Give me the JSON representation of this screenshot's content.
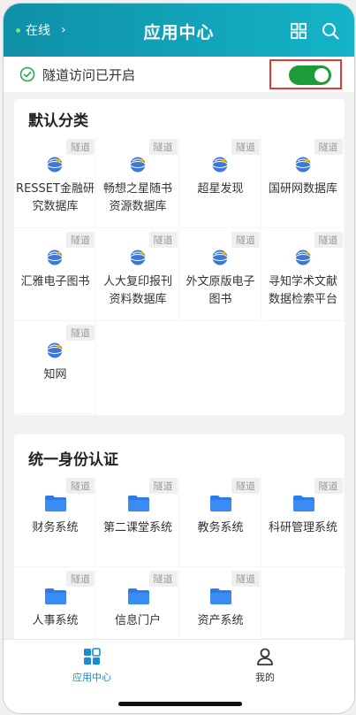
{
  "header": {
    "status_label": "在线",
    "title": "应用中心",
    "icons": [
      "chevron-right-icon",
      "grid-icon",
      "search-icon"
    ]
  },
  "tunnel": {
    "text": "隧道访问已开启",
    "enabled": true,
    "colors": {
      "toggle_on": "#1f9c3a",
      "highlight_border": "#e53935"
    }
  },
  "sections": [
    {
      "title": "默认分类",
      "icon": "globe-icon",
      "apps": [
        {
          "label": "RESSET金融研究数据库",
          "badge": "隧道"
        },
        {
          "label": "畅想之星随书资源数据库",
          "badge": "隧道"
        },
        {
          "label": "超星发现",
          "badge": "隧道"
        },
        {
          "label": "国研网数据库",
          "badge": "隧道"
        },
        {
          "label": "汇雅电子图书",
          "badge": "隧道"
        },
        {
          "label": "人大复印报刊资料数据库",
          "badge": "隧道"
        },
        {
          "label": "外文原版电子图书",
          "badge": "隧道"
        },
        {
          "label": "寻知学术文献数据检索平台",
          "badge": "隧道"
        },
        {
          "label": "知网",
          "badge": "隧道"
        }
      ]
    },
    {
      "title": "统一身份认证",
      "icon": "folder-icon",
      "apps": [
        {
          "label": "财务系统",
          "badge": "隧道"
        },
        {
          "label": "第二课堂系统",
          "badge": "隧道"
        },
        {
          "label": "教务系统",
          "badge": "隧道"
        },
        {
          "label": "科研管理系统",
          "badge": "隧道"
        },
        {
          "label": "人事系统",
          "badge": "隧道"
        },
        {
          "label": "信息门户",
          "badge": "隧道"
        },
        {
          "label": "资产系统",
          "badge": "隧道"
        }
      ]
    }
  ],
  "bottom_nav": [
    {
      "label": "应用中心",
      "icon": "apps-icon",
      "active": true
    },
    {
      "label": "我的",
      "icon": "user-icon",
      "active": false
    }
  ]
}
